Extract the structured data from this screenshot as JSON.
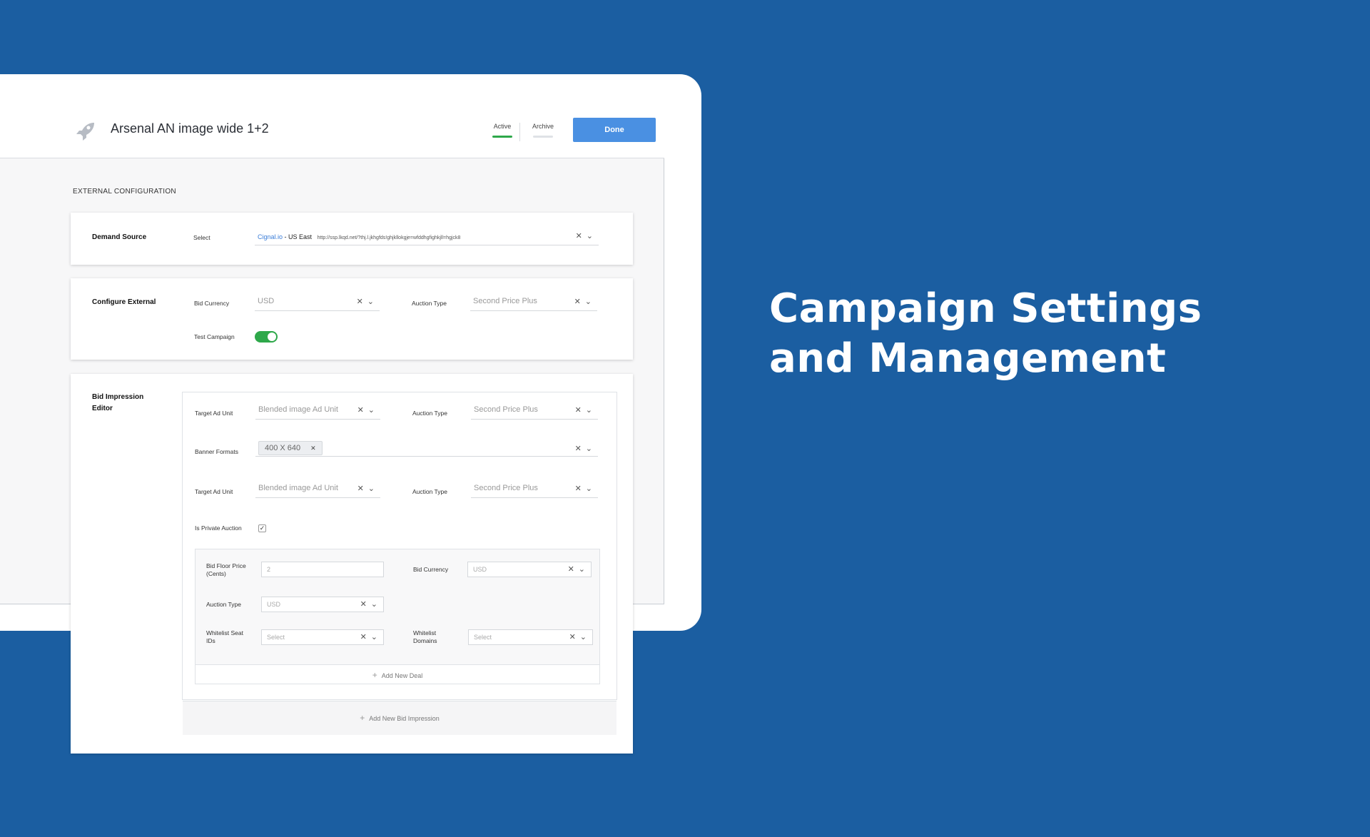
{
  "header": {
    "title": "Arsenal AN image wide 1+2",
    "status_active": "Active",
    "status_archive": "Archive",
    "done_label": "Done"
  },
  "section_heading": "EXTERNAL CONFIGURATION",
  "demand_source": {
    "title": "Demand Source",
    "select_label": "Select",
    "source_link": "Cignal.io",
    "source_sep": " - ",
    "region": "US East",
    "url": "http://ssp.lkqd.net/?thj.l.jkhgfds!ghjkllokgje=wfddhgfighkjll=hgjck8"
  },
  "configure_external": {
    "title": "Configure External",
    "bid_currency_label": "Bid Currency",
    "bid_currency_value": "USD",
    "auction_type_label": "Auction Type",
    "auction_type_value": "Second Price Plus",
    "test_campaign_label": "Test Campaign",
    "test_campaign_on": true
  },
  "bid_impression": {
    "title_line1": "Bid Impression",
    "title_line2": "Editor",
    "row1": {
      "target_label": "Target Ad Unit",
      "target_value": "Blended image Ad Unit",
      "auction_label": "Auction Type",
      "auction_value": "Second Price Plus"
    },
    "banner_formats_label": "Banner Formats",
    "banner_chip": "400 X 640",
    "row2": {
      "target_label": "Target Ad Unit",
      "target_value": "Blended image Ad Unit",
      "auction_label": "Auction Type",
      "auction_value": "Second Price Plus"
    },
    "private_auction_label": "Is Private Auction",
    "private_auction_checked": true,
    "deal": {
      "floor_label_line1": "Bid Floor Price",
      "floor_label_line2": "(Cents)",
      "floor_value": "2",
      "currency_label": "Bid Currency",
      "currency_value": "USD",
      "auction_label": "Auction Type",
      "auction_value": "USD",
      "seat_label_line1": "Whitelist Seat",
      "seat_label_line2": "IDs",
      "seat_value": "Select",
      "domains_label_line1": "Whitelist",
      "domains_label_line2": "Domains",
      "domains_value": "Select",
      "add_deal_label": "Add New Deal"
    },
    "add_impression_label": "Add New Bid Impression"
  },
  "headline": {
    "line1": "Campaign Settings",
    "line2": "and Management"
  },
  "colors": {
    "background": "#1b5ea1",
    "primary_button": "#4a90e2",
    "toggle_on": "#2ea84a",
    "link": "#3b7dd8"
  },
  "icons": {
    "logo": "rocket-icon",
    "clear": "close-icon",
    "expand": "chevron-down-icon",
    "add": "plus-icon",
    "check": "check-icon"
  }
}
